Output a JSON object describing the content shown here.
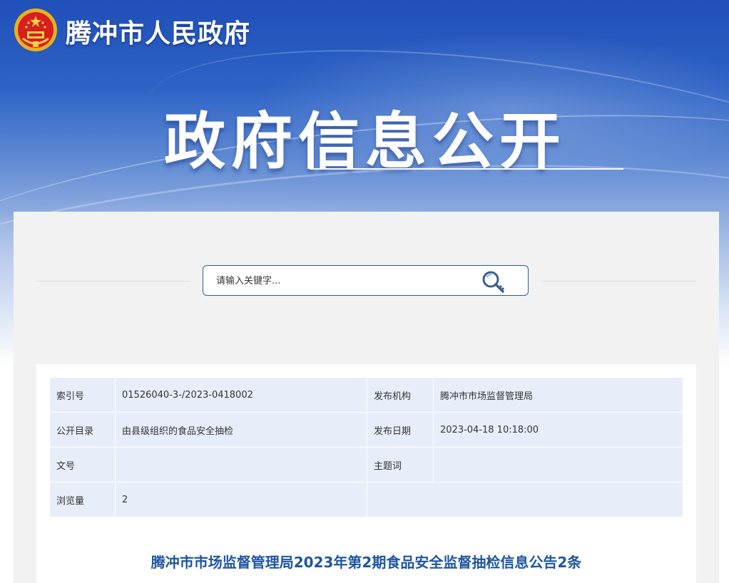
{
  "header": {
    "site_title": "腾冲市人民政府",
    "banner_title": "政府信息公开"
  },
  "search": {
    "placeholder": "请输入关键字..."
  },
  "meta": {
    "rows": [
      {
        "label1": "索引号",
        "value1": "01526040-3-/2023-0418002",
        "label2": "发布机构",
        "value2": "腾冲市市场监督管理局"
      },
      {
        "label1": "公开目录",
        "value1": "由县级组织的食品安全抽检",
        "label2": "发布日期",
        "value2": "2023-04-18 10:18:00"
      },
      {
        "label1": "文号",
        "value1": "",
        "label2": "主题词",
        "value2": ""
      },
      {
        "label1": "浏览量",
        "value1": "2"
      }
    ]
  },
  "document": {
    "title": "腾冲市市场监督管理局2023年第2期食品安全监督抽检信息公告2条"
  },
  "colors": {
    "accent": "#1e56a0",
    "table_bg": "#e8eef9",
    "search_border": "#2e5d93"
  }
}
